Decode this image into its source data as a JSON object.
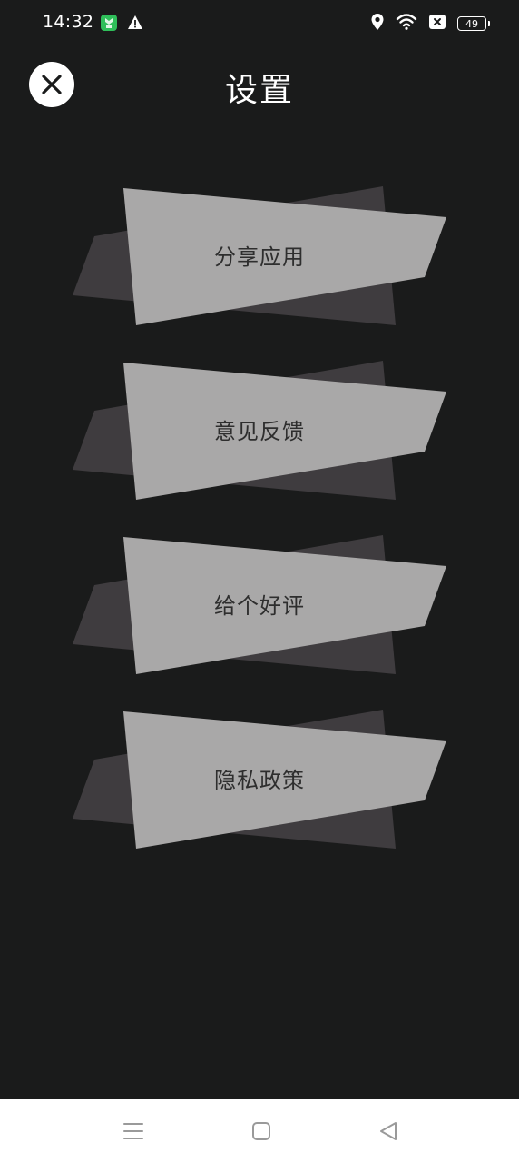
{
  "status_bar": {
    "time": "14:32",
    "battery": "49",
    "icons": [
      "app-notification-icon",
      "warning-icon",
      "location-icon",
      "wifi-icon",
      "sim-off-icon",
      "battery-icon"
    ]
  },
  "header": {
    "title": "设置",
    "close_icon": "close-icon"
  },
  "menu": {
    "items": [
      {
        "id": "share",
        "label": "分享应用"
      },
      {
        "id": "feedback",
        "label": "意见反馈"
      },
      {
        "id": "rate",
        "label": "给个好评"
      },
      {
        "id": "privacy",
        "label": "隐私政策"
      }
    ]
  },
  "colors": {
    "background": "#1a1b1b",
    "card_front": "#a9a8a8",
    "card_back": "#3f3c3f",
    "nav_background": "#ffffff"
  },
  "nav_bar": {
    "icons": [
      "menu-icon",
      "home-icon",
      "back-icon"
    ]
  }
}
